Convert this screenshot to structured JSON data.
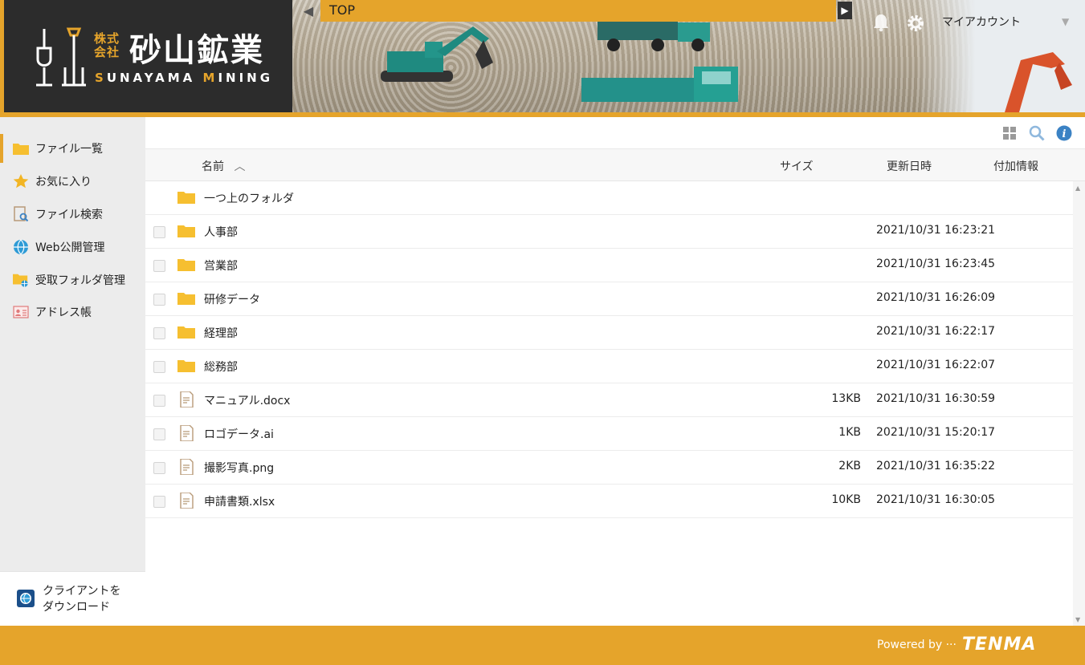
{
  "header": {
    "logo_small": "株式\n会社",
    "logo_big": "砂山鉱業",
    "logo_en_a": "S",
    "logo_en_b": "UNAYAMA ",
    "logo_en_c": "M",
    "logo_en_d": "INING",
    "breadcrumb": "TOP",
    "account_label": "マイアカウント"
  },
  "sidebar": {
    "items": [
      {
        "label": "ファイル一覧",
        "icon": "folder-icon"
      },
      {
        "label": "お気に入り",
        "icon": "star-icon"
      },
      {
        "label": "ファイル検索",
        "icon": "file-search-icon"
      },
      {
        "label": "Web公開管理",
        "icon": "globe-icon"
      },
      {
        "label": "受取フォルダ管理",
        "icon": "receive-folder-icon"
      },
      {
        "label": "アドレス帳",
        "icon": "address-book-icon"
      }
    ],
    "download_line1": "クライアントを",
    "download_line2": "ダウンロード"
  },
  "columns": {
    "name": "名前",
    "size": "サイズ",
    "updated": "更新日時",
    "extra": "付加情報"
  },
  "files": [
    {
      "name": "一つ上のフォルダ",
      "type": "parent",
      "size": "",
      "date": ""
    },
    {
      "name": "人事部",
      "type": "folder",
      "size": "",
      "date": "2021/10/31 16:23:21"
    },
    {
      "name": "営業部",
      "type": "folder",
      "size": "",
      "date": "2021/10/31 16:23:45"
    },
    {
      "name": "研修データ",
      "type": "folder",
      "size": "",
      "date": "2021/10/31 16:26:09"
    },
    {
      "name": "経理部",
      "type": "folder",
      "size": "",
      "date": "2021/10/31 16:22:17"
    },
    {
      "name": "総務部",
      "type": "folder",
      "size": "",
      "date": "2021/10/31 16:22:07"
    },
    {
      "name": "マニュアル.docx",
      "type": "file",
      "size": "13KB",
      "date": "2021/10/31 16:30:59"
    },
    {
      "name": "ロゴデータ.ai",
      "type": "file",
      "size": "1KB",
      "date": "2021/10/31 15:20:17"
    },
    {
      "name": "撮影写真.png",
      "type": "file",
      "size": "2KB",
      "date": "2021/10/31 16:35:22"
    },
    {
      "name": "申請書類.xlsx",
      "type": "file",
      "size": "10KB",
      "date": "2021/10/31 16:30:05"
    }
  ],
  "footer": {
    "powered": "Powered by ···",
    "brand": "TENMA"
  },
  "colors": {
    "accent": "#e5a42b",
    "logo_bg": "#2c2c2c",
    "folder": "#f6bf30",
    "info": "#3b82c4"
  }
}
